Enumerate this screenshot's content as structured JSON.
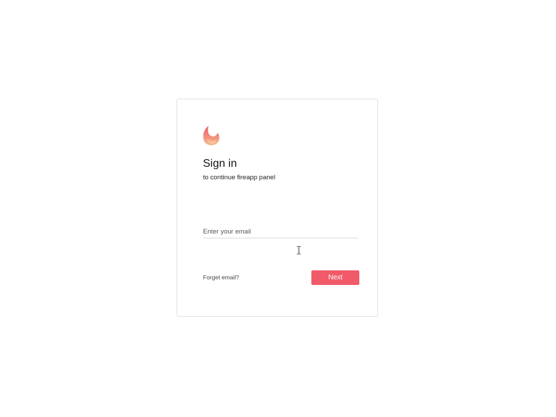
{
  "brand": {
    "logo_icon": "flame-icon",
    "colors": {
      "accent": "#f05a69",
      "flame_top": "#f0566b",
      "flame_bottom": "#f6b98a"
    }
  },
  "signin": {
    "title": "Sign in",
    "subtitle": "to continue fireapp panel",
    "email_placeholder": "Enter your email",
    "email_value": "",
    "forget_email_label": "Forget email?",
    "next_label": "Next"
  },
  "pointer": {
    "icon": "text-cursor-icon"
  }
}
